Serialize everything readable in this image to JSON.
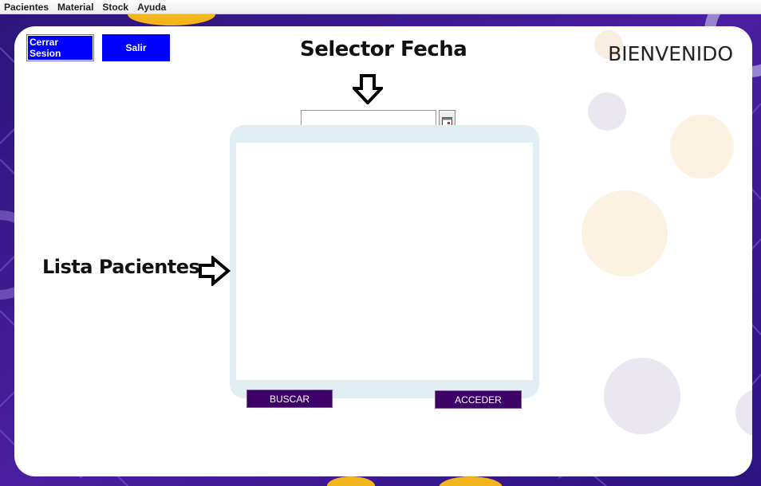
{
  "menu": [
    "Pacientes",
    "Material",
    "Stock",
    "Ayuda"
  ],
  "buttons": {
    "logout": "Cerrar Sesion",
    "exit": "Salir",
    "search": "BUSCAR",
    "access": "ACCEDER"
  },
  "labels": {
    "date_selector": "Selector Fecha",
    "welcome": "BIENVENIDO",
    "patient_list": "Lista Pacientes"
  },
  "date_field": {
    "value": ""
  },
  "patients": [],
  "colors": {
    "blue_button": "#0000ff",
    "dark_button": "#3d0066",
    "list_frame": "#e1eef4",
    "background": "#3a1a8a"
  },
  "icons": [
    "calendar-icon",
    "down-arrow-icon",
    "right-arrow-icon"
  ]
}
